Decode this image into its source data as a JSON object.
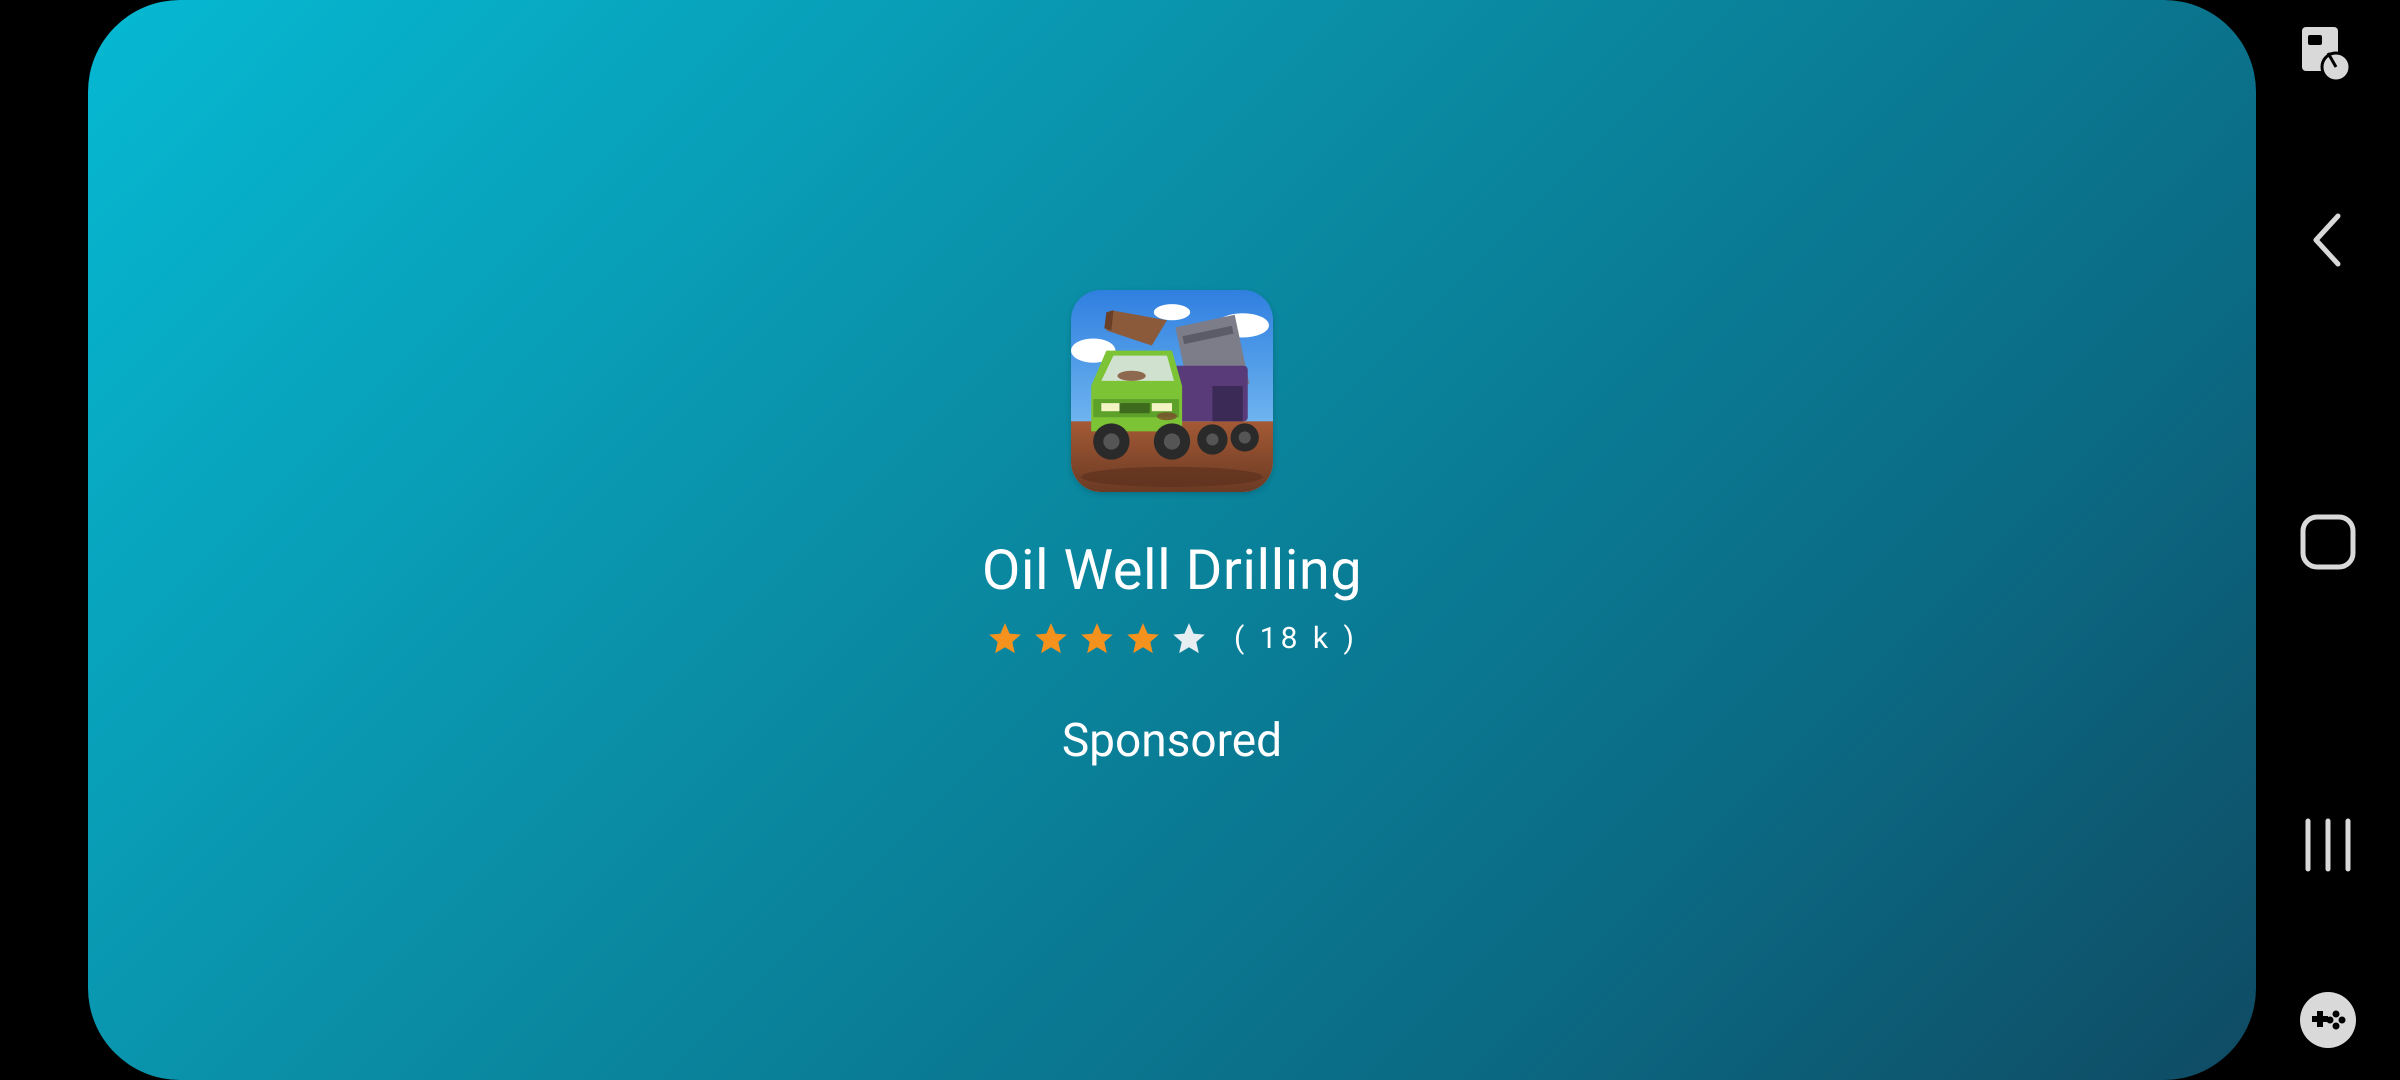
{
  "ad": {
    "app_title": "Oil Well Drilling",
    "rating": 4,
    "rating_max": 5,
    "rating_count": "( 18 k )",
    "sponsored_label": "Sponsored",
    "colors": {
      "gradient_start": "#06b9d3",
      "gradient_end": "#0f4b63",
      "star_filled": "#f5921e",
      "star_empty": "#e6eef2"
    }
  },
  "navbar": {
    "buttons": [
      {
        "icon": "screen-touch-icon"
      },
      {
        "icon": "back-icon"
      },
      {
        "icon": "home-icon"
      },
      {
        "icon": "recent-apps-icon"
      },
      {
        "icon": "game-controller-icon"
      }
    ]
  }
}
